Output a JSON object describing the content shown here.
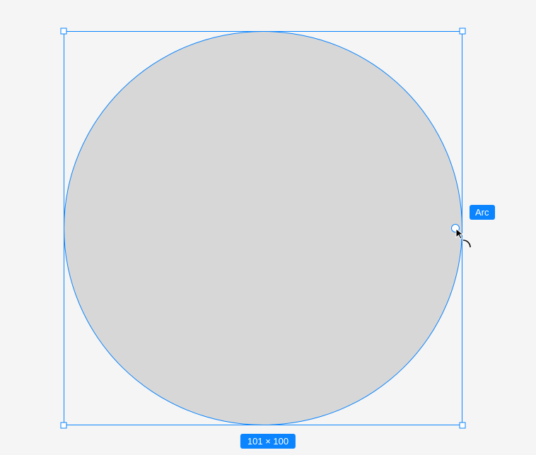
{
  "canvas": {
    "selection": {
      "shape": "ellipse",
      "width": 101,
      "height": 100,
      "dimensions_label": "101 × 100"
    },
    "arc_tool": {
      "tooltip": "Arc"
    }
  },
  "colors": {
    "selection_blue": "#0a84ff",
    "shape_fill": "#d7d7d7",
    "canvas_bg": "#f5f5f5"
  }
}
